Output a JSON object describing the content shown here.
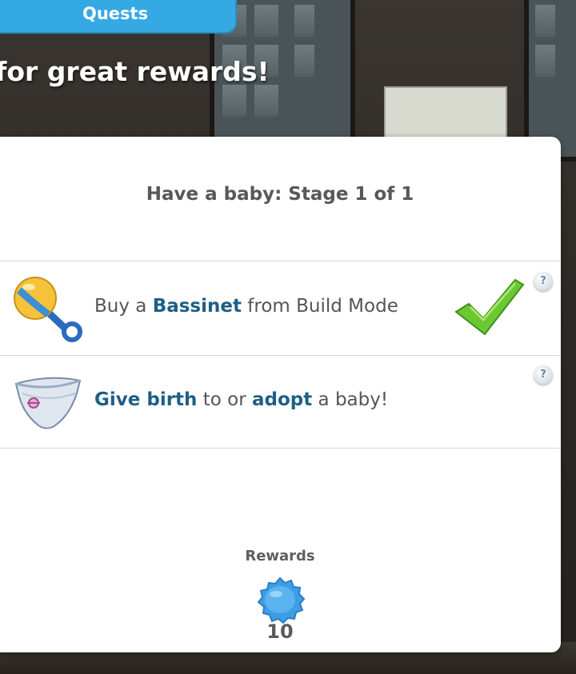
{
  "header": {
    "tab_label": "Quests",
    "headline": "for great rewards!"
  },
  "quest": {
    "stage_title": "Have a baby: Stage 1 of 1",
    "tasks": [
      {
        "icon": "rattle-icon",
        "prefix": "Buy a ",
        "highlight": "Bassinet",
        "suffix": " from Build Mode",
        "completed": true,
        "help": "?"
      },
      {
        "icon": "diaper-icon",
        "highlight1": "Give birth",
        "middle": " to or ",
        "highlight2": "adopt",
        "suffix": " a baby!",
        "completed": false,
        "help": "?"
      }
    ]
  },
  "rewards": {
    "label": "Rewards",
    "icon": "blue-gem-badge-icon",
    "amount": "10"
  },
  "colors": {
    "accent_blue": "#35a9e3",
    "highlight_text": "#1e5f86",
    "check_green": "#6cc832"
  }
}
